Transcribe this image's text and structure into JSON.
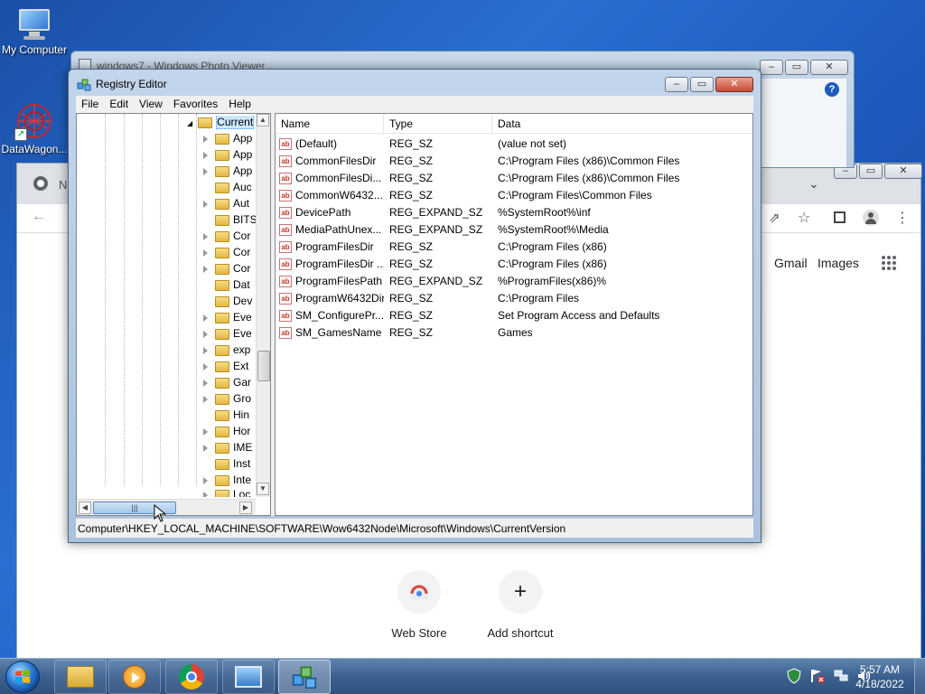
{
  "desktop": {
    "icons": [
      {
        "label": "My Computer"
      },
      {
        "label": "DataWagon..."
      }
    ]
  },
  "photo_viewer": {
    "title": "windows7 - Windows Photo Viewer"
  },
  "chrome": {
    "tab_initial": "N",
    "ntp": {
      "gmail": "Gmail",
      "images": "Images",
      "shortcuts": [
        {
          "label": "Web Store",
          "icon": "webstore-icon"
        },
        {
          "label": "Add shortcut",
          "icon": "+"
        }
      ]
    }
  },
  "registry": {
    "title": "Registry Editor",
    "menu": [
      "File",
      "Edit",
      "View",
      "Favorites",
      "Help"
    ],
    "tree_items": [
      "Current",
      "App",
      "App",
      "App",
      "Auc",
      "Aut",
      "BITS",
      "Cor",
      "Cor",
      "Cor",
      "Dat",
      "Dev",
      "Eve",
      "Eve",
      "exp",
      "Ext",
      "Gar",
      "Gro",
      "Hin",
      "Hor",
      "IME",
      "Inst",
      "Inte",
      "Loc"
    ],
    "columns": [
      "Name",
      "Type",
      "Data"
    ],
    "rows": [
      {
        "name": "(Default)",
        "type": "REG_SZ",
        "data": "(value not set)"
      },
      {
        "name": "CommonFilesDir",
        "type": "REG_SZ",
        "data": "C:\\Program Files (x86)\\Common Files"
      },
      {
        "name": "CommonFilesDi...",
        "type": "REG_SZ",
        "data": "C:\\Program Files (x86)\\Common Files"
      },
      {
        "name": "CommonW6432...",
        "type": "REG_SZ",
        "data": "C:\\Program Files\\Common Files"
      },
      {
        "name": "DevicePath",
        "type": "REG_EXPAND_SZ",
        "data": "%SystemRoot%\\inf"
      },
      {
        "name": "MediaPathUnex...",
        "type": "REG_EXPAND_SZ",
        "data": "%SystemRoot%\\Media"
      },
      {
        "name": "ProgramFilesDir",
        "type": "REG_SZ",
        "data": "C:\\Program Files (x86)"
      },
      {
        "name": "ProgramFilesDir ...",
        "type": "REG_SZ",
        "data": "C:\\Program Files (x86)"
      },
      {
        "name": "ProgramFilesPath",
        "type": "REG_EXPAND_SZ",
        "data": "%ProgramFiles(x86)%"
      },
      {
        "name": "ProgramW6432Dir",
        "type": "REG_SZ",
        "data": "C:\\Program Files"
      },
      {
        "name": "SM_ConfigurePr...",
        "type": "REG_SZ",
        "data": "Set Program Access and Defaults"
      },
      {
        "name": "SM_GamesName",
        "type": "REG_SZ",
        "data": "Games"
      }
    ],
    "status_path": "Computer\\HKEY_LOCAL_MACHINE\\SOFTWARE\\Wow6432Node\\Microsoft\\Windows\\CurrentVersion"
  },
  "taskbar": {
    "apps": [
      "explorer-icon",
      "media-player-icon",
      "chrome-icon",
      "photo-viewer-icon",
      "regedit-icon"
    ],
    "active_app": "regedit-icon",
    "time": "5:57 AM",
    "date": "4/18/2022"
  }
}
